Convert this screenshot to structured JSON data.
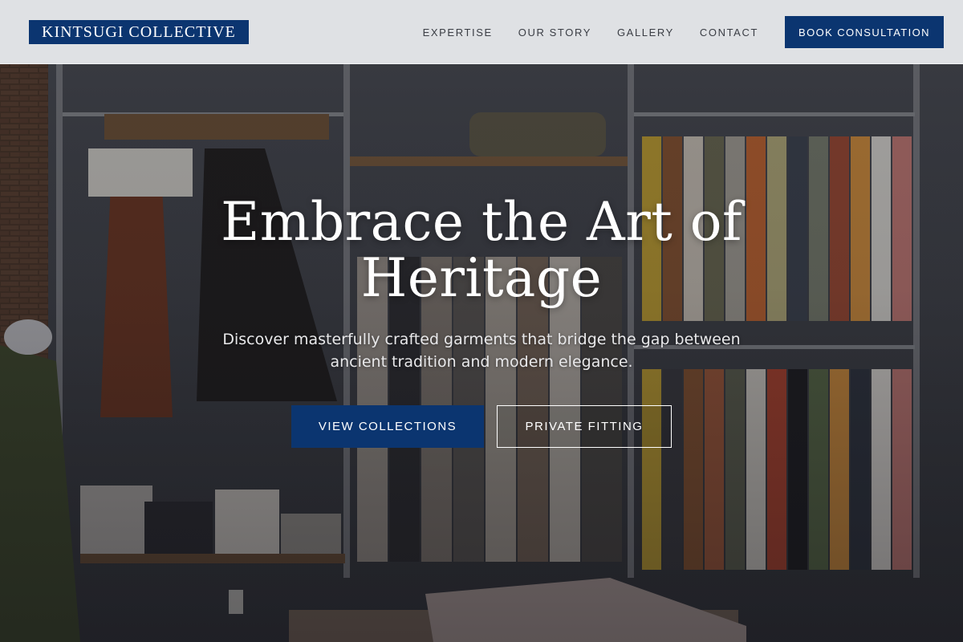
{
  "brand": {
    "logo_text": "KINTSUGI COLLECTIVE",
    "accent_color": "#0b3570"
  },
  "nav": {
    "items": [
      {
        "label": "EXPERTISE"
      },
      {
        "label": "OUR STORY"
      },
      {
        "label": "GALLERY"
      },
      {
        "label": "CONTACT"
      }
    ],
    "cta_label": "BOOK CONSULTATION"
  },
  "hero": {
    "title": "Embrace the Art of Heritage",
    "subtitle": "Discover masterfully crafted garments that bridge the gap between ancient tradition and modern elegance.",
    "primary_button": "VIEW COLLECTIONS",
    "secondary_button": "PRIVATE FITTING",
    "background": "boutique-clothing-racks-photo"
  }
}
